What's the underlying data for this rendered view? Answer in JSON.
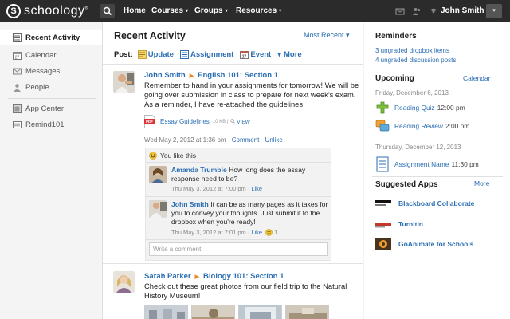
{
  "brand": {
    "name": "schoology",
    "mark": "®"
  },
  "nav": {
    "home": "Home",
    "courses": "Courses",
    "groups": "Groups",
    "resources": "Resources",
    "user": "John Smith",
    "caret": "▾"
  },
  "sidebar": {
    "items": [
      {
        "label": "Recent Activity",
        "icon": "recent-activity-icon"
      },
      {
        "label": "Calendar",
        "icon": "calendar-icon"
      },
      {
        "label": "Messages",
        "icon": "messages-icon"
      },
      {
        "label": "People",
        "icon": "people-icon"
      },
      {
        "label": "App Center",
        "icon": "app-center-icon"
      },
      {
        "label": "Remind101",
        "icon": "remind101-icon"
      }
    ]
  },
  "main": {
    "title": "Recent Activity",
    "filter": "Most Recent ▾",
    "post_label": "Post:",
    "post_options": {
      "update": "Update",
      "assignment": "Assignment",
      "event": "Event",
      "more": "More"
    },
    "post1": {
      "author": "John Smith",
      "course": "English 101: Section 1",
      "line1": "Remember to hand in your assignments for tomorrow! We will be",
      "line2": "going over submission in class to prepare for next week's exam.",
      "line3": "As a reminder, I have re-attached the guidelines.",
      "attachment": "Essay Guidelines",
      "size": "10 KB |",
      "view": "VIEW",
      "date": "Wed May 2, 2012 at 1:36 pm",
      "comment": "Comment",
      "unlike": "Unlike",
      "likes": "You like this",
      "comments": [
        {
          "name": "Amanda Trumble",
          "line1": "How long does the essay",
          "line2": "response need to be?",
          "date": "Thu May 3, 2012 at 7:00 pm",
          "like": "Like"
        },
        {
          "name": "John Smith",
          "line1": "It can be as many pages as it takes for",
          "line2": "you to convey your thoughts. Just submit it to the",
          "line3": "dropbox when you're ready!",
          "date": "Thu May 3, 2012 at 7:01 pm",
          "like": "Like",
          "like_count": "1"
        }
      ],
      "write_placeholder": "Write a comment"
    },
    "post2": {
      "author": "Sarah Parker",
      "course": "Biology 101: Section 1",
      "line1": "Check out these great photos from our field trip to the Natural",
      "line2": "History Museum!"
    },
    "separator": "·"
  },
  "right": {
    "reminders_title": "Reminders",
    "reminders": [
      "3 ungraded dropbox items",
      "4 ungraded discussion posts"
    ],
    "upcoming_title": "Upcoming",
    "calendar_link": "Calendar",
    "day1": "Friday, December 6, 2013",
    "events_day1": [
      {
        "name": "Reading Quiz",
        "time": "12:00 pm",
        "icon": "quiz-icon"
      },
      {
        "name": "Reading Review",
        "time": "2:00 pm",
        "icon": "discussion-icon"
      }
    ],
    "day2": "Thursday, December 12, 2013",
    "events_day2": [
      {
        "name": "Assignment Name",
        "time": "11:30 pm",
        "icon": "assignment-icon"
      }
    ],
    "apps_title": "Suggested Apps",
    "apps_more": "More",
    "apps": [
      {
        "name": "Blackboard Collaborate",
        "icon": "blackboard-collaborate-logo"
      },
      {
        "name": "Turnitin",
        "icon": "turnitin-logo"
      },
      {
        "name": "GoAnimate for Schools",
        "icon": "goanimate-logo"
      }
    ]
  },
  "colors": {
    "nav_bg": "#2b2b2b",
    "link": "#2b6eb3",
    "accent_orange": "#e58a2a",
    "page_bg": "#f4f4f4"
  }
}
